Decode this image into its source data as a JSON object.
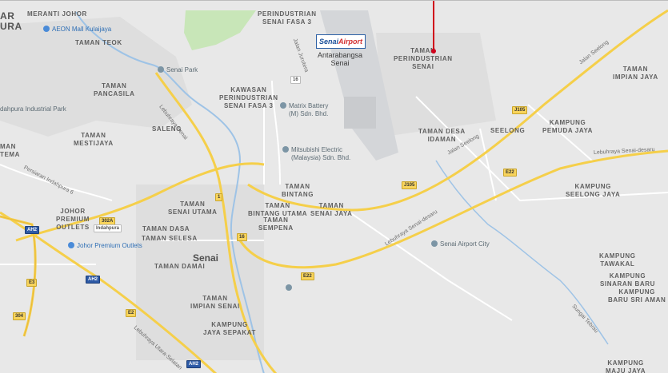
{
  "map": {
    "colors": {
      "land": "#e8e8e8",
      "highway": "#f5cf4a",
      "road": "#ffffff",
      "water": "#9ec3e6",
      "park": "#c8e6b8",
      "airport": "#d4d6d9",
      "marker": "#d0021b"
    },
    "areas": {
      "meranti": "MERANTI JOHOR",
      "ar": "AR",
      "ura": "URA",
      "teok": "TAMAN TEOK",
      "kip3": "KAWASAN\nPERINDUSTRIAN\nSENAI FASA 3",
      "kip3_top": "PERINDUSTRIAN\nSENAI FASA 3",
      "tps": "TAMAN\nPERINDUSTRIAN\nSENAI",
      "pancasila": "TAMAN\nPANCASILA",
      "saleng": "SALENG",
      "mestijaya": "TAMAN\nMESTIJAYA",
      "man_tema": "MAN\nTEMA",
      "impianjaya": "TAMAN\nIMPIAN JAYA",
      "pemuda": "KAMPUNG\nPEMUDA JAYA",
      "desaidaman": "TAMAN DESA\nIDAMAN",
      "seelong": "SEELONG",
      "seelongjaya": "KAMPUNG\nSEELONG JAYA",
      "bintang": "TAMAN\nBINTANG",
      "bintangutama": "TAMAN\nBINTANG UTAMA",
      "senaijaya": "TAMAN\nSENAI JAYA",
      "sempena": "TAMAN\nSEMPENA",
      "senaiutama": "TAMAN\nSENAI UTAMA",
      "dasa": "TAMAN DASA",
      "selesa": "TAMAN SELESA",
      "damai": "TAMAN DAMAI",
      "johorpremium": "JOHOR\nPREMIUM\nOUTLETS",
      "impiansenai": "TAMAN\nIMPIAN SENAI",
      "jayasepakat": "KAMPUNG\nJAYA SEPAKAT",
      "tawakal": "KAMPUNG\nTAWAKAL",
      "sinaran": "KAMPUNG\nSINARAN BARU",
      "sriaman": "KAMPUNG\nBARU SRI AMAN",
      "majujaya": "KAMPUNG\nMAJU JAYA"
    },
    "city": "Senai",
    "airport": {
      "logo_a": "Senai",
      "logo_b": "Airport",
      "name": "Antarabangsa\nSenai"
    },
    "pois": {
      "aeon": "AEON Mall Kulaijaya",
      "senaipark": "Senai Park",
      "industrialpark": "dahpura Industrial Park",
      "matrix": "Matrix Battery\n(M) Sdn. Bhd.",
      "mitsubishi": "Mitsubishi Electric\n(Malaysia) Sdn. Bhd.",
      "jpo": "Johor Premium Outlets",
      "airportcity": "Senai Airport City"
    },
    "roads": {
      "lebuhraya_senai": "Lebuhraya Senai",
      "persiaran": "Persiaran Indahpura 6",
      "jalan_seelong_top": "Jalan Seelong",
      "jalan_seelong": "Jalan Seelong",
      "senai_desaru_top": "Lebuhraya Senai-desaru",
      "senai_desaru": "Lebuhraya Senai-desaru",
      "utara_selatan": "Lebuhraya Utara-Selatan",
      "sungai": "Sungai Tebrau",
      "jalan_jurutera": "Jalan Jurutera"
    },
    "shields": {
      "j105a": "J105",
      "j105b": "J105",
      "e22a": "E22",
      "e22b": "E22",
      "r16a": "16",
      "r16b": "16",
      "r1": "1",
      "r302a": "302A",
      "indahpura": "Indahpura",
      "ah2a": "AH2",
      "ah2b": "AH2",
      "ah2c": "AH2",
      "e3": "E3",
      "e2": "E2",
      "r304": "304"
    }
  }
}
